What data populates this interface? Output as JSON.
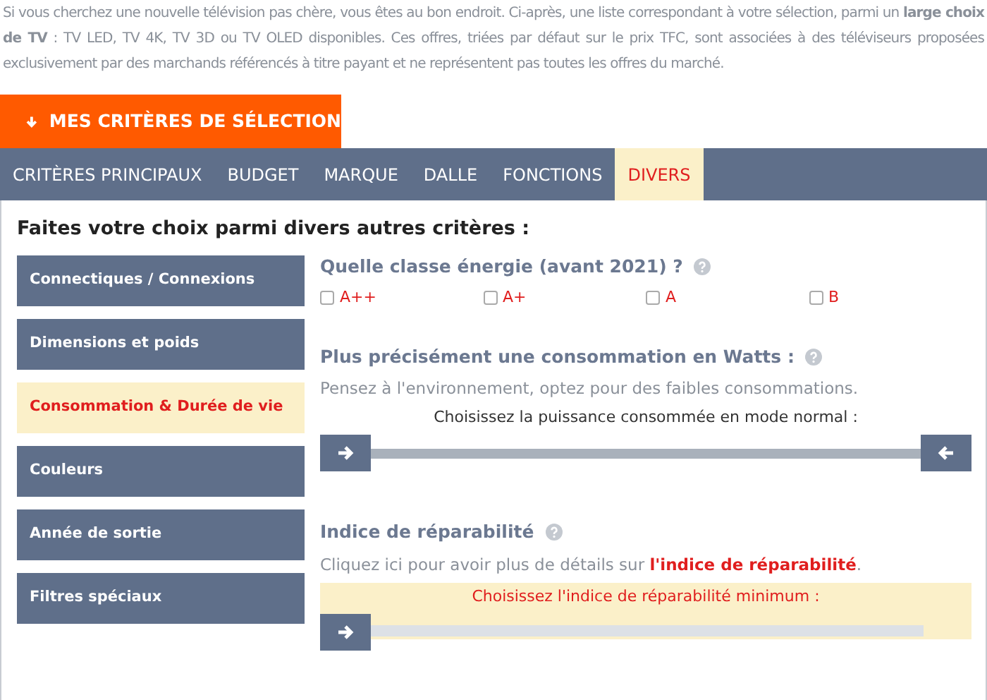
{
  "intro": "Si vous cherchez une nouvelle télévision pas chère, vous êtes au bon endroit. Ci-après, une liste correspondant à votre sélection, parmi un **large choix de TV** : TV LED, TV 4K, TV 3D ou TV OLED disponibles. Ces offres, triées par défaut sur le prix TFC, sont associées à des téléviseurs proposées exclusivement par des marchands référencés à titre payant et ne représentent pas toutes les offres du marché.",
  "criteria_button": "MES CRITÈRES DE SÉLECTION",
  "tabs": [
    {
      "label": "CRITÈRES PRINCIPAUX",
      "selected": false
    },
    {
      "label": "BUDGET",
      "selected": false
    },
    {
      "label": "MARQUE",
      "selected": false
    },
    {
      "label": "DALLE",
      "selected": false
    },
    {
      "label": "FONCTIONS",
      "selected": false
    },
    {
      "label": "DIVERS",
      "selected": true
    }
  ],
  "panel_title": "Faites votre choix parmi divers autres critères :",
  "sidebar": {
    "items": [
      {
        "label": "Connectiques / Connexions",
        "selected": false
      },
      {
        "label": "Dimensions et poids",
        "selected": false
      },
      {
        "label": "Consommation & Durée de vie",
        "selected": true
      },
      {
        "label": "Couleurs",
        "selected": false
      },
      {
        "label": "Année de sortie",
        "selected": false
      },
      {
        "label": "Filtres spéciaux",
        "selected": false
      }
    ]
  },
  "energy": {
    "title": "Quelle classe énergie (avant 2021) ?",
    "options": [
      {
        "label": "A++",
        "checked": false
      },
      {
        "label": "A+",
        "checked": false
      },
      {
        "label": "A",
        "checked": false
      },
      {
        "label": "B",
        "checked": false
      }
    ]
  },
  "watts": {
    "title": "Plus précisément une consommation en Watts :",
    "hint": "Pensez à l'environnement, optez pour des faibles consommations.",
    "slider_label": "Choisissez la puissance consommée en mode normal :",
    "handles": [
      {
        "level": 0
      },
      {
        "level": 1
      }
    ]
  },
  "repair": {
    "title": "Indice de réparabilité",
    "text": "Cliquez ici pour avoir plus de détails sur ",
    "link": "l'indice de réparabilité",
    "text_end": ".",
    "slider_label": "Choisissez l'indice de réparabilité minimum :",
    "handle": {
      "level": 0
    }
  }
}
